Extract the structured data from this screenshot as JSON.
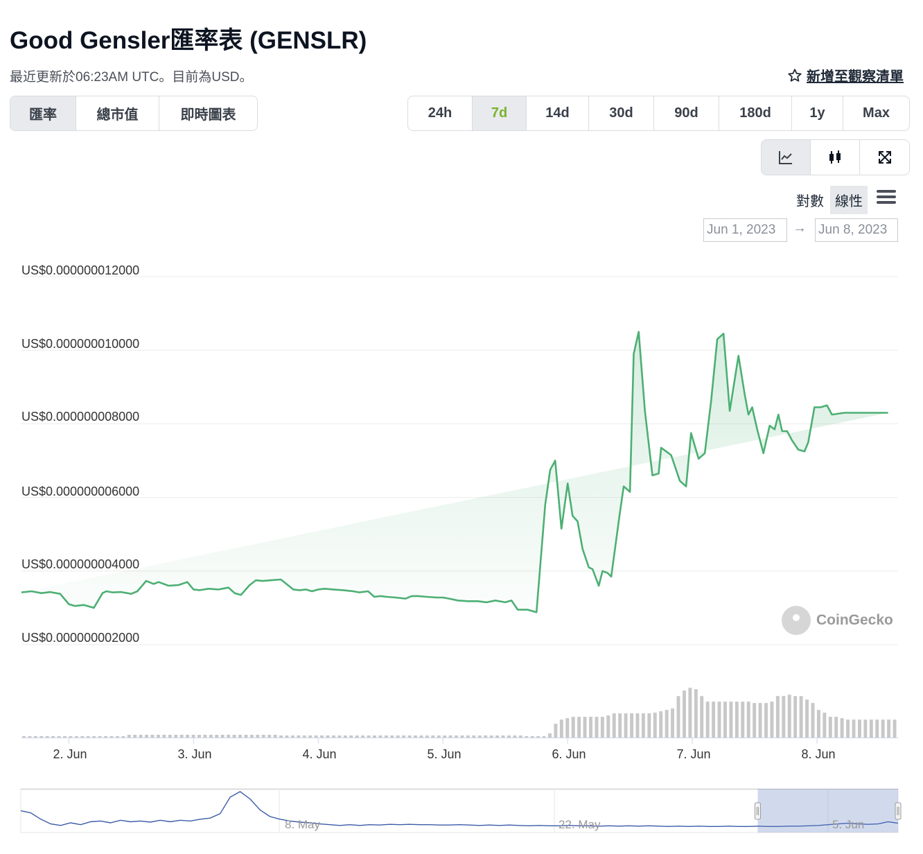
{
  "header": {
    "title": "Good Gensler匯率表 (GENSLR)",
    "subtitle": "最近更新於06:23AM UTC。目前為USD。",
    "watchlist_label": "新增至觀察清單"
  },
  "tabs": [
    {
      "label": "匯率",
      "active": true
    },
    {
      "label": "總市值",
      "active": false
    },
    {
      "label": "即時圖表",
      "active": false
    }
  ],
  "ranges": [
    {
      "label": "24h",
      "active": false
    },
    {
      "label": "7d",
      "active": true
    },
    {
      "label": "14d",
      "active": false
    },
    {
      "label": "30d",
      "active": false
    },
    {
      "label": "90d",
      "active": false
    },
    {
      "label": "180d",
      "active": false
    },
    {
      "label": "1y",
      "active": false
    },
    {
      "label": "Max",
      "active": false
    }
  ],
  "chart_types": [
    {
      "icon": "line-chart-icon",
      "active": true
    },
    {
      "icon": "candlestick-icon",
      "active": false
    },
    {
      "icon": "expand-icon",
      "active": false
    }
  ],
  "scale": {
    "log_label": "對數",
    "linear_label": "線性",
    "selected": "linear"
  },
  "date_range": {
    "from": "Jun 1, 2023",
    "to": "Jun 8, 2023"
  },
  "watermark": "CoinGecko",
  "colors": {
    "line": "#4caf73",
    "accent_7d": "#7ab22d",
    "volume": "#c8c8c8",
    "navigator": "#3b5aa8"
  },
  "chart_data": {
    "type": "area",
    "x_axis_labels": [
      "2. Jun",
      "3. Jun",
      "4. Jun",
      "5. Jun",
      "6. Jun",
      "7. Jun",
      "8. Jun"
    ],
    "y_tick_labels": [
      "US$0.000000012000",
      "US$0.000000010000",
      "US$0.000000008000",
      "US$0.000000006000",
      "US$0.000000004000",
      "US$0.000000002000"
    ],
    "y_ticks": [
      12,
      10,
      8,
      6,
      4,
      2
    ],
    "value_scale_note": "values in units of 1e-9 USD",
    "ylim": [
      2,
      12
    ],
    "xlim": [
      1.62,
      8.65
    ],
    "grid": true,
    "price_series": {
      "name": "GENSLR",
      "x": [
        1.62,
        1.7,
        1.78,
        1.85,
        1.93,
        2.0,
        2.05,
        2.12,
        2.2,
        2.27,
        2.3,
        2.35,
        2.42,
        2.5,
        2.55,
        2.62,
        2.68,
        2.72,
        2.8,
        2.88,
        2.95,
        3.0,
        3.05,
        3.12,
        3.2,
        3.28,
        3.33,
        3.38,
        3.45,
        3.5,
        3.55,
        3.62,
        3.7,
        3.8,
        3.85,
        3.9,
        3.95,
        4.0,
        4.05,
        4.12,
        4.2,
        4.28,
        4.33,
        4.4,
        4.45,
        4.5,
        4.55,
        4.62,
        4.7,
        4.75,
        4.8,
        4.87,
        4.95,
        5.0,
        5.05,
        5.12,
        5.2,
        5.28,
        5.35,
        5.42,
        5.5,
        5.55,
        5.6,
        5.68,
        5.75,
        5.82,
        5.86,
        5.9,
        5.95,
        6.0,
        6.04,
        6.08,
        6.12,
        6.17,
        6.2,
        6.25,
        6.28,
        6.32,
        6.35,
        6.42,
        6.45,
        6.5,
        6.53,
        6.57,
        6.62,
        6.68,
        6.73,
        6.75,
        6.79,
        6.83,
        6.9,
        6.95,
        6.99,
        7.05,
        7.1,
        7.15,
        7.2,
        7.25,
        7.3,
        7.37,
        7.42,
        7.45,
        7.48,
        7.52,
        7.57,
        7.62,
        7.66,
        7.69,
        7.72,
        7.76,
        7.8,
        7.85,
        7.9,
        7.93,
        7.98,
        8.03,
        8.08,
        8.12,
        8.18,
        8.22,
        8.26,
        8.33,
        8.38,
        8.42,
        8.48,
        8.52,
        8.57,
        8.62,
        8.65
      ],
      "values": [
        3.42,
        3.45,
        3.4,
        3.43,
        3.38,
        3.1,
        3.05,
        3.08,
        3.0,
        3.4,
        3.45,
        3.42,
        3.43,
        3.38,
        3.45,
        3.73,
        3.65,
        3.7,
        3.6,
        3.62,
        3.7,
        3.5,
        3.48,
        3.52,
        3.5,
        3.55,
        3.4,
        3.35,
        3.62,
        3.75,
        3.73,
        3.75,
        3.77,
        3.5,
        3.48,
        3.5,
        3.45,
        3.5,
        3.52,
        3.5,
        3.48,
        3.45,
        3.42,
        3.45,
        3.3,
        3.32,
        3.3,
        3.28,
        3.25,
        3.32,
        3.32,
        3.3,
        3.28,
        3.28,
        3.25,
        3.2,
        3.18,
        3.18,
        3.15,
        3.2,
        3.15,
        3.2,
        2.95,
        2.95,
        2.88,
        5.8,
        6.75,
        7.0,
        5.15,
        6.38,
        5.5,
        5.35,
        4.6,
        4.1,
        4.05,
        3.6,
        4.0,
        3.95,
        3.85,
        5.6,
        6.3,
        6.15,
        9.9,
        10.5,
        8.35,
        6.6,
        6.65,
        7.35,
        7.25,
        7.15,
        6.45,
        6.3,
        7.75,
        7.05,
        7.2,
        8.6,
        10.3,
        10.45,
        8.35,
        9.85,
        8.8,
        8.25,
        8.45,
        7.85,
        7.2,
        7.95,
        7.85,
        8.25,
        7.8,
        7.8,
        7.55,
        7.3,
        7.25,
        7.5,
        8.45,
        8.45,
        8.5,
        8.25,
        8.28,
        8.3,
        8.3,
        8.3,
        8.3,
        8.3,
        8.3,
        8.3,
        8.3
      ]
    },
    "volume_series": {
      "name": "Volume",
      "relative_values": [
        0.02,
        0.02,
        0.02,
        0.02,
        0.02,
        0.02,
        0.02,
        0.02,
        0.02,
        0.02,
        0.02,
        0.02,
        0.02,
        0.02,
        0.02,
        0.02,
        0.02,
        0.02,
        0.04,
        0.04,
        0.04,
        0.04,
        0.04,
        0.04,
        0.04,
        0.04,
        0.04,
        0.04,
        0.04,
        0.04,
        0.04,
        0.04,
        0.04,
        0.04,
        0.04,
        0.04,
        0.04,
        0.04,
        0.04,
        0.04,
        0.04,
        0.04,
        0.04,
        0.04,
        0.03,
        0.03,
        0.03,
        0.03,
        0.03,
        0.03,
        0.03,
        0.03,
        0.03,
        0.03,
        0.03,
        0.03,
        0.03,
        0.03,
        0.03,
        0.03,
        0.03,
        0.03,
        0.03,
        0.03,
        0.03,
        0.03,
        0.03,
        0.03,
        0.03,
        0.03,
        0.03,
        0.03,
        0.03,
        0.03,
        0.03,
        0.03,
        0.03,
        0.03,
        0.03,
        0.03,
        0.03,
        0.03,
        0.03,
        0.03,
        0.03,
        0.03,
        0.02,
        0.02,
        0.02,
        0.02,
        0.06,
        0.2,
        0.26,
        0.28,
        0.3,
        0.3,
        0.3,
        0.3,
        0.3,
        0.3,
        0.32,
        0.35,
        0.35,
        0.35,
        0.35,
        0.35,
        0.35,
        0.35,
        0.36,
        0.38,
        0.4,
        0.42,
        0.6,
        0.68,
        0.72,
        0.7,
        0.6,
        0.52,
        0.52,
        0.52,
        0.52,
        0.52,
        0.52,
        0.52,
        0.52,
        0.5,
        0.5,
        0.5,
        0.52,
        0.6,
        0.6,
        0.62,
        0.6,
        0.6,
        0.55,
        0.5,
        0.4,
        0.36,
        0.3,
        0.3,
        0.28,
        0.26,
        0.26,
        0.26,
        0.26,
        0.26,
        0.26,
        0.26,
        0.26,
        0.26
      ]
    },
    "navigator": {
      "labels": [
        "8. May",
        "22. May",
        "5. Jun"
      ],
      "relative_values": [
        0.48,
        0.42,
        0.25,
        0.12,
        0.08,
        0.15,
        0.1,
        0.18,
        0.2,
        0.15,
        0.22,
        0.18,
        0.2,
        0.17,
        0.22,
        0.18,
        0.22,
        0.2,
        0.25,
        0.28,
        0.4,
        0.85,
        1.0,
        0.8,
        0.5,
        0.32,
        0.25,
        0.2,
        0.17,
        0.15,
        0.12,
        0.1,
        0.08,
        0.1,
        0.08,
        0.1,
        0.09,
        0.11,
        0.1,
        0.11,
        0.1,
        0.1,
        0.09,
        0.09,
        0.1,
        0.09,
        0.08,
        0.09,
        0.08,
        0.09,
        0.08,
        0.07,
        0.08,
        0.07,
        0.07,
        0.08,
        0.07,
        0.07,
        0.06,
        0.07,
        0.06,
        0.07,
        0.06,
        0.07,
        0.06,
        0.05,
        0.06,
        0.05,
        0.06,
        0.05,
        0.05,
        0.06,
        0.05,
        0.05,
        0.06,
        0.05,
        0.05,
        0.06,
        0.06,
        0.07,
        0.08,
        0.1,
        0.12,
        0.14,
        0.12,
        0.11,
        0.12,
        0.18,
        0.14
      ],
      "selected_range_fraction": [
        0.84,
        1.0
      ]
    }
  }
}
